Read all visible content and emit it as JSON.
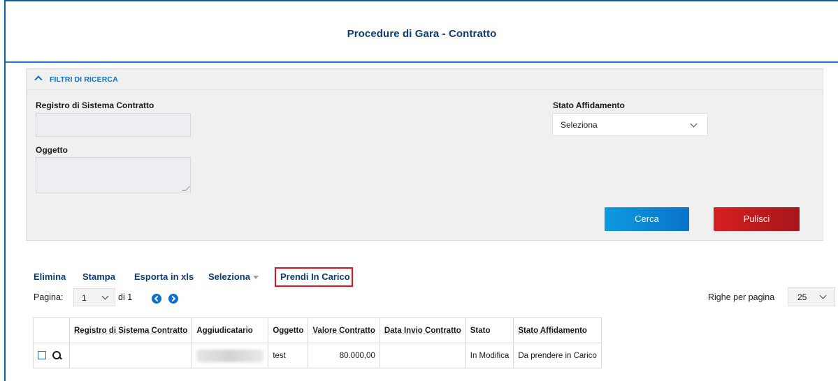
{
  "page": {
    "title": "Procedure di Gara - Contratto"
  },
  "filters": {
    "header": "FILTRI DI RICERCA",
    "registro_label": "Registro di Sistema Contratto",
    "registro_value": "",
    "oggetto_label": "Oggetto",
    "oggetto_value": "",
    "stato_affidamento_label": "Stato Affidamento",
    "stato_affidamento_value": "Seleziona",
    "search_button": "Cerca",
    "clear_button": "Pulisci"
  },
  "toolbar": {
    "delete": "Elimina",
    "print": "Stampa",
    "export": "Esporta in xls",
    "select": "Seleziona",
    "take_charge": "Prendi In Carico"
  },
  "pagination": {
    "page_label": "Pagina:",
    "current_page": "1",
    "of_label": "di 1",
    "rows_label": "Righe per pagina",
    "rows_value": "25"
  },
  "table": {
    "columns": [
      "Registro di Sistema Contratto",
      "Aggiudicatario",
      "Oggetto",
      "Valore Contratto",
      "Data Invio Contratto",
      "Stato",
      "Stato Affidamento"
    ],
    "rows": [
      {
        "registro": "",
        "aggiudicatario": "",
        "oggetto": "test",
        "valore": "80.000,00",
        "data_invio": "",
        "stato": "In Modifica",
        "stato_affidamento": "Da prendere in Carico"
      }
    ]
  },
  "colors": {
    "primary_blue": "#0a6fcf",
    "title_navy": "#0d3b75",
    "danger_red": "#d81f1f",
    "highlight": "#e8101b"
  }
}
